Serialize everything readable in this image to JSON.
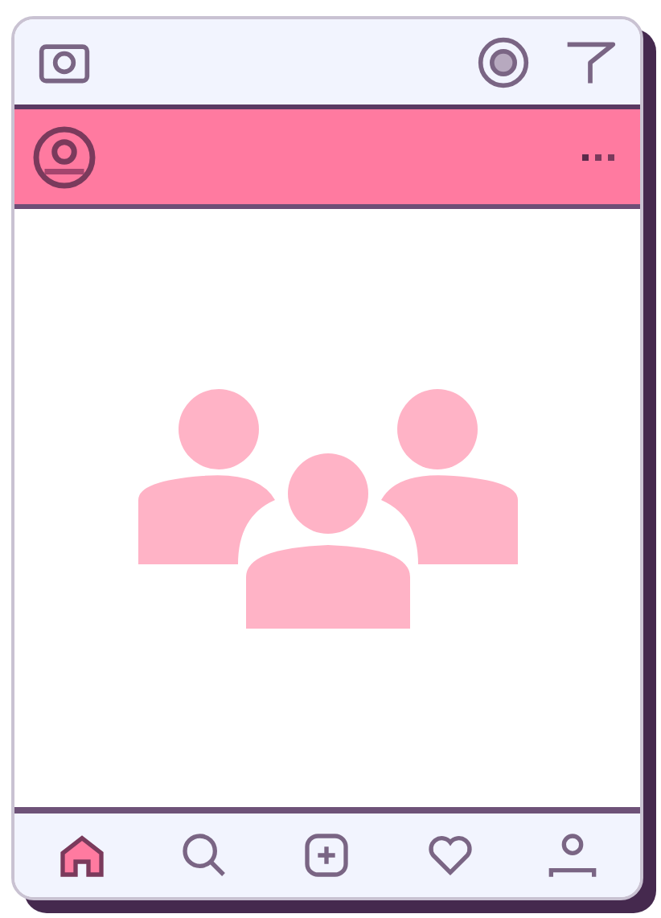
{
  "top_bar": {
    "actions": [
      {
        "kind": "camera"
      },
      {
        "kind": "target"
      },
      {
        "kind": "send"
      }
    ]
  },
  "post_header": {
    "kind": "avatar"
  },
  "post": {
    "kind": "group"
  },
  "bottom_nav": [
    {
      "kind": "home",
      "selected": true
    },
    {
      "kind": "search",
      "selected": false
    },
    {
      "kind": "add",
      "selected": false
    },
    {
      "kind": "heart",
      "selected": false
    },
    {
      "kind": "profile",
      "selected": false
    }
  ]
}
